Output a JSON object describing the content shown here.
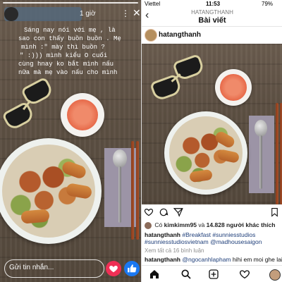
{
  "story": {
    "time": "1 giờ",
    "more_icon": "more-dots-icon",
    "close_icon": "close-icon",
    "caption_lines": [
      "Sáng nay nói với mẹ , là",
      "sao con thấy buồn buồn . Mẹ",
      "mình :\" mày thì buồn  ?",
      "\" :))) mình kiểu O  cuối",
      "cùng hnay ko bắt mình nấu",
      "nữa mà mẹ vào nấu cho mình"
    ],
    "reply_placeholder": "Gửi tin nhắn...",
    "heart_icon": "heart-icon",
    "like_icon": "thumbs-up-icon"
  },
  "post": {
    "status": {
      "carrier": "Viettel",
      "time": "11:53",
      "battery": "79%"
    },
    "nav": {
      "username": "HATANGTHANH",
      "title": "Bài viết"
    },
    "author": "hatangthanh",
    "likes": {
      "user": "kimkimm95",
      "count": "14.828",
      "text_prefix": "Có",
      "text_suffix": "người khác thích",
      "connector": "và"
    },
    "caption": {
      "author": "hatangthanh",
      "tags_line1": "#Breakfast #sunniesstudios",
      "tags_line2": "#sunniesstudiosvietnam @madhousesaigon"
    },
    "view_comments": "Xem tất cả 16 bình luận",
    "comment": {
      "author": "hatangthanh",
      "mention": "@ngocanhlapham",
      "text": "hihi em moi ghe lai an"
    },
    "accent_color": "#1f3f7a"
  }
}
